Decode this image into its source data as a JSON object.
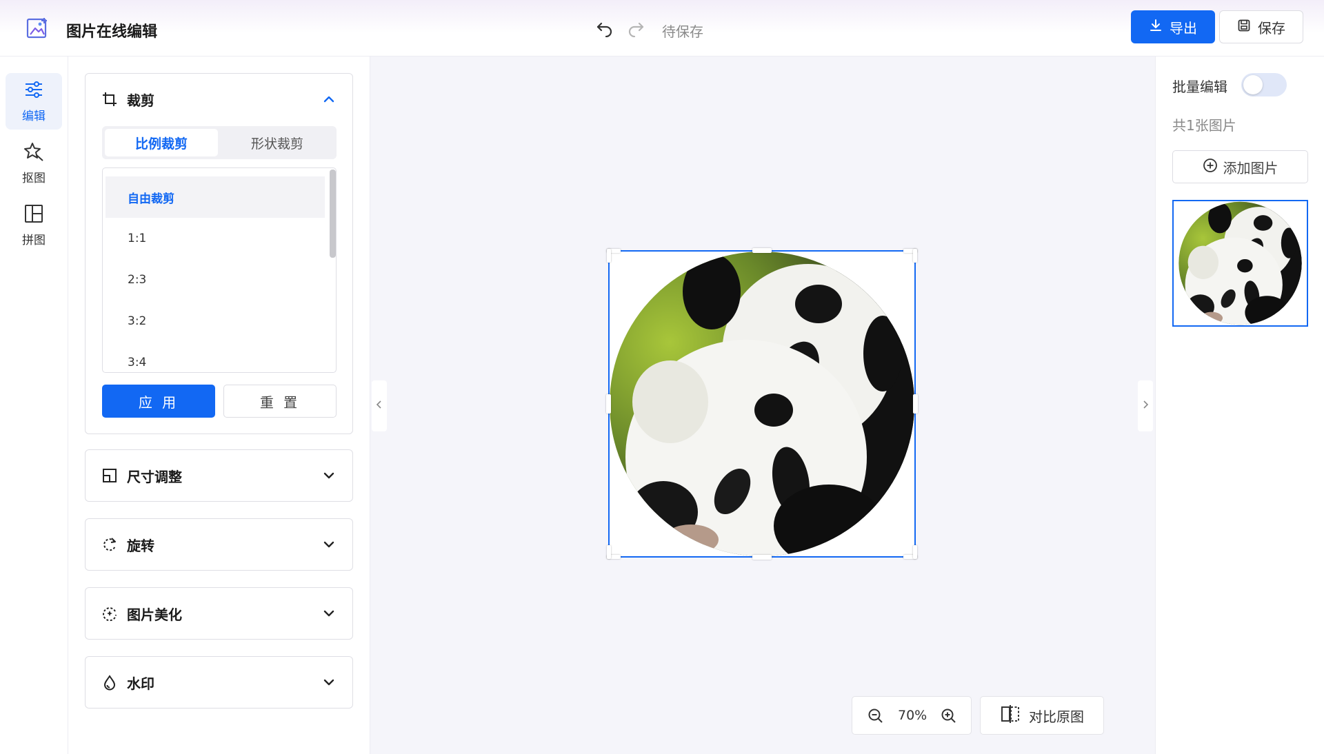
{
  "header": {
    "title": "图片在线编辑",
    "save_status": "待保存",
    "export_label": "导出",
    "save_label": "保存"
  },
  "rail": {
    "items": [
      {
        "label": "编辑",
        "icon": "sliders-icon"
      },
      {
        "label": "抠图",
        "icon": "magic-star-icon"
      },
      {
        "label": "拼图",
        "icon": "layout-grid-icon"
      }
    ]
  },
  "crop": {
    "title": "裁剪",
    "tabs": [
      "比例裁剪",
      "形状裁剪"
    ],
    "ratios": [
      "自由裁剪",
      "1:1",
      "2:3",
      "3:2",
      "3:4"
    ],
    "apply_label": "应 用",
    "reset_label": "重 置"
  },
  "sections": [
    {
      "title": "尺寸调整",
      "icon": "resize-icon"
    },
    {
      "title": "旋转",
      "icon": "rotate-icon"
    },
    {
      "title": "图片美化",
      "icon": "beautify-icon"
    },
    {
      "title": "水印",
      "icon": "water-drop-icon"
    }
  ],
  "canvas": {
    "zoom": "70%",
    "compare_label": "对比原图"
  },
  "right": {
    "batch_label": "批量编辑",
    "count_label": "共1张图片",
    "add_label": "添加图片"
  },
  "colors": {
    "accent": "#1268f3"
  }
}
